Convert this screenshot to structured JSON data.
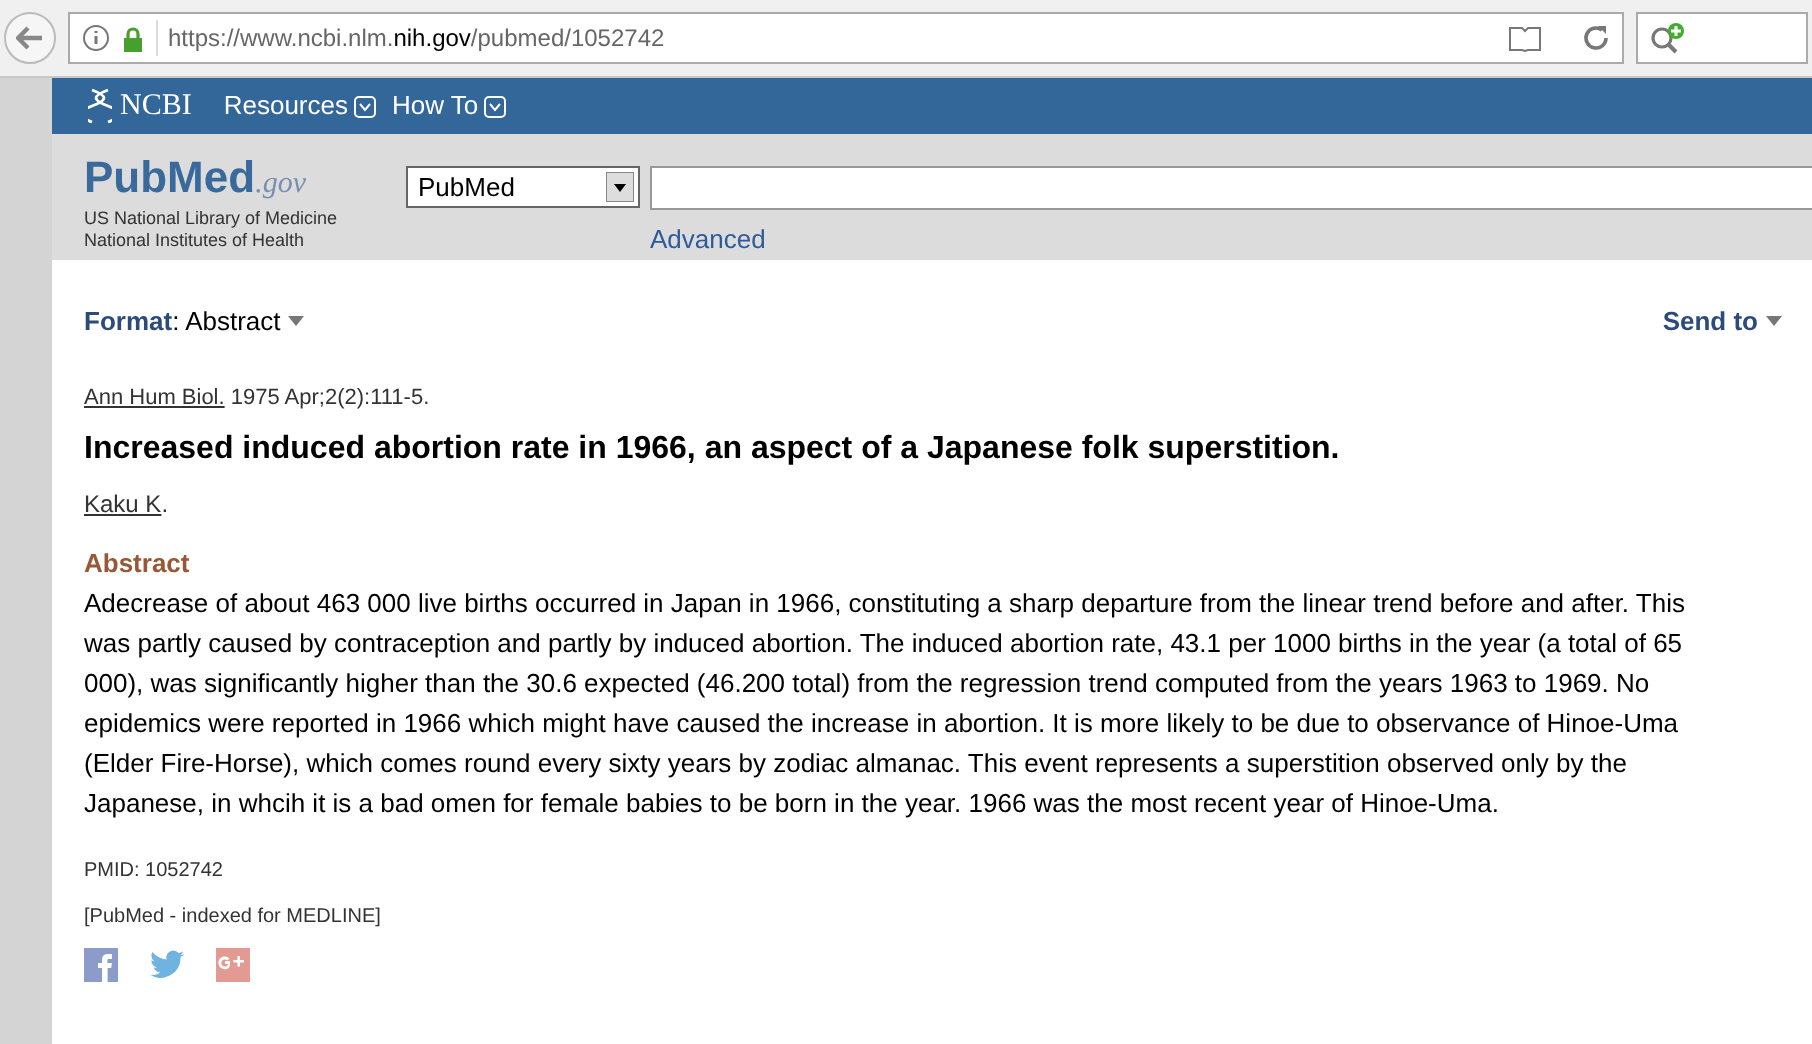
{
  "browser": {
    "url": "https://www.ncbi.nlm.**nih.gov**/pubmed/1052742"
  },
  "ncbi_bar": {
    "logo": "NCBI",
    "menus": [
      {
        "label": "Resources"
      },
      {
        "label": "How To"
      }
    ]
  },
  "header": {
    "logo": {
      "name": "PubMed",
      "suffix": ".gov"
    },
    "org_lines": [
      "US National Library of Medicine",
      "National Institutes of Health"
    ],
    "database": "PubMed",
    "advanced": "Advanced"
  },
  "toolbar": {
    "format_label": "Format",
    "format_value": ": Abstract",
    "send_to": "Send to"
  },
  "article": {
    "journal": "Ann Hum Biol.",
    "citation": " 1975 Apr;2(2):111-5.",
    "title": "Increased induced abortion rate in 1966, an aspect of a Japanese folk superstition.",
    "author": "Kaku K",
    "author_suffix": ".",
    "abstract_heading": "Abstract",
    "abstract": "Adecrease of about 463 000 live births occurred in Japan in 1966, constituting a sharp departure from the linear trend before and after. This was partly caused by contraception and partly by induced abortion. The induced abortion rate, 43.1 per 1000 births in the year (a total of 65 000), was significantly higher than the 30.6 expected (46.200 total) from the regression trend computed from the years 1963 to 1969. No epidemics were reported in 1966 which might have caused the increase in abortion. It is more likely to be due to observance of Hinoe-Uma (Elder Fire-Horse), which comes round every sixty years by zodiac almanac. This event represents a superstition observed only by the Japanese, in whcih it is a bad omen for female babies to be born in the year. 1966 was the most recent year of Hinoe-Uma.",
    "pmid": "PMID: 1052742",
    "status": "[PubMed - indexed for MEDLINE]"
  },
  "share": [
    {
      "kind": "facebook"
    },
    {
      "kind": "twitter"
    },
    {
      "kind": "googleplus"
    }
  ]
}
